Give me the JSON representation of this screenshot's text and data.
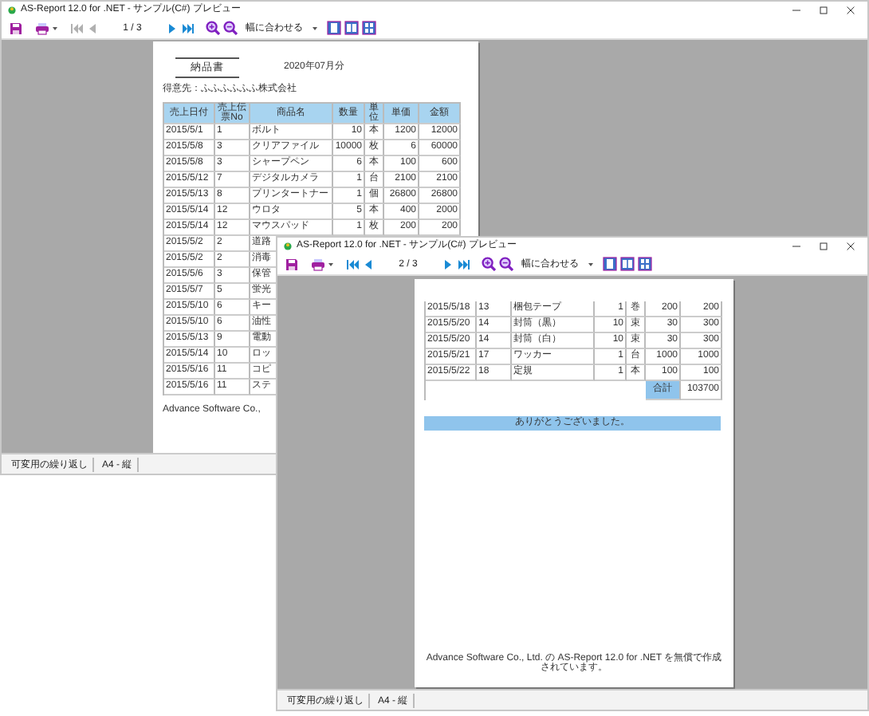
{
  "windows": [
    {
      "title": "AS-Report 12.0 for .NET - サンプル(C#) プレビュー",
      "toolbar": {
        "nav": [
          {
            "kind": "first",
            "disabled": true
          },
          {
            "kind": "prev",
            "disabled": true
          },
          {
            "kind": "page",
            "text": "1 / 3"
          },
          {
            "kind": "next",
            "disabled": false
          },
          {
            "kind": "last",
            "disabled": false
          }
        ],
        "zoom_mode": "幅に合わせる"
      },
      "page": {
        "kind": "first",
        "title": "納品書",
        "date": "2020年07月分",
        "customer": "得意先：ふふふふふふ株式会社",
        "table": {
          "columns": [
            "売上日付",
            "売上伝票No",
            "商品名",
            "数量",
            "単位",
            "単価",
            "金額"
          ],
          "rows": [
            [
              "2015/5/1",
              "1",
              "ボルト",
              "10",
              "本",
              "1200",
              "12000"
            ],
            [
              "2015/5/8",
              "3",
              "クリアファイル",
              "10000",
              "枚",
              "6",
              "60000"
            ],
            [
              "2015/5/8",
              "3",
              "シャープペン",
              "6",
              "本",
              "100",
              "600"
            ],
            [
              "2015/5/12",
              "7",
              "デジタルカメラ",
              "1",
              "台",
              "2100",
              "2100"
            ],
            [
              "2015/5/13",
              "8",
              "プリンタートナー",
              "1",
              "個",
              "26800",
              "26800"
            ],
            [
              "2015/5/14",
              "12",
              "ウロタ",
              "5",
              "本",
              "400",
              "2000"
            ],
            [
              "2015/5/14",
              "12",
              "マウスパッド",
              "1",
              "枚",
              "200",
              "200"
            ],
            [
              "2015/5/2",
              "2",
              "道路"
            ],
            [
              "2015/5/2",
              "2",
              "消毒"
            ],
            [
              "2015/5/6",
              "3",
              "保管"
            ],
            [
              "2015/5/7",
              "5",
              "蛍光"
            ],
            [
              "2015/5/10",
              "6",
              "キー"
            ],
            [
              "2015/5/10",
              "6",
              "油性"
            ],
            [
              "2015/5/13",
              "9",
              "電動"
            ],
            [
              "2015/5/14",
              "10",
              "ロッ"
            ],
            [
              "2015/5/16",
              "11",
              "コピ"
            ],
            [
              "2015/5/16",
              "11",
              "ステ"
            ]
          ]
        },
        "footer": "Advance Software Co.,"
      },
      "status_bar": [
        "可変用の繰り返し",
        "A4 - 縦"
      ]
    },
    {
      "title": "AS-Report 12.0 for .NET - サンプル(C#) プレビュー",
      "toolbar": {
        "nav": [
          {
            "kind": "first",
            "disabled": false
          },
          {
            "kind": "prev",
            "disabled": false
          },
          {
            "kind": "page",
            "text": "2 / 3"
          },
          {
            "kind": "next",
            "disabled": false
          },
          {
            "kind": "last",
            "disabled": false
          }
        ],
        "zoom_mode": "幅に合わせる"
      },
      "page": {
        "kind": "continued",
        "table": {
          "rows": [
            [
              "2015/5/18",
              "13",
              "梱包テープ",
              "1",
              "巻",
              "200",
              "200"
            ],
            [
              "2015/5/20",
              "14",
              "封筒（黒）",
              "10",
              "束",
              "30",
              "300"
            ],
            [
              "2015/5/20",
              "14",
              "封筒（白）",
              "10",
              "束",
              "30",
              "300"
            ],
            [
              "2015/5/21",
              "17",
              "ワッカー",
              "1",
              "台",
              "1000",
              "1000"
            ],
            [
              "2015/5/22",
              "18",
              "定規",
              "1",
              "本",
              "100",
              "100"
            ]
          ],
          "total_label": "合計",
          "total_value": "103700"
        },
        "message": "ありがとうございました。",
        "footer": "Advance Software Co., Ltd. の AS-Report 12.0 for .NET を無償で作成されています。"
      },
      "status_bar": [
        "可変用の繰り返し",
        "A4 - 縦"
      ]
    }
  ]
}
